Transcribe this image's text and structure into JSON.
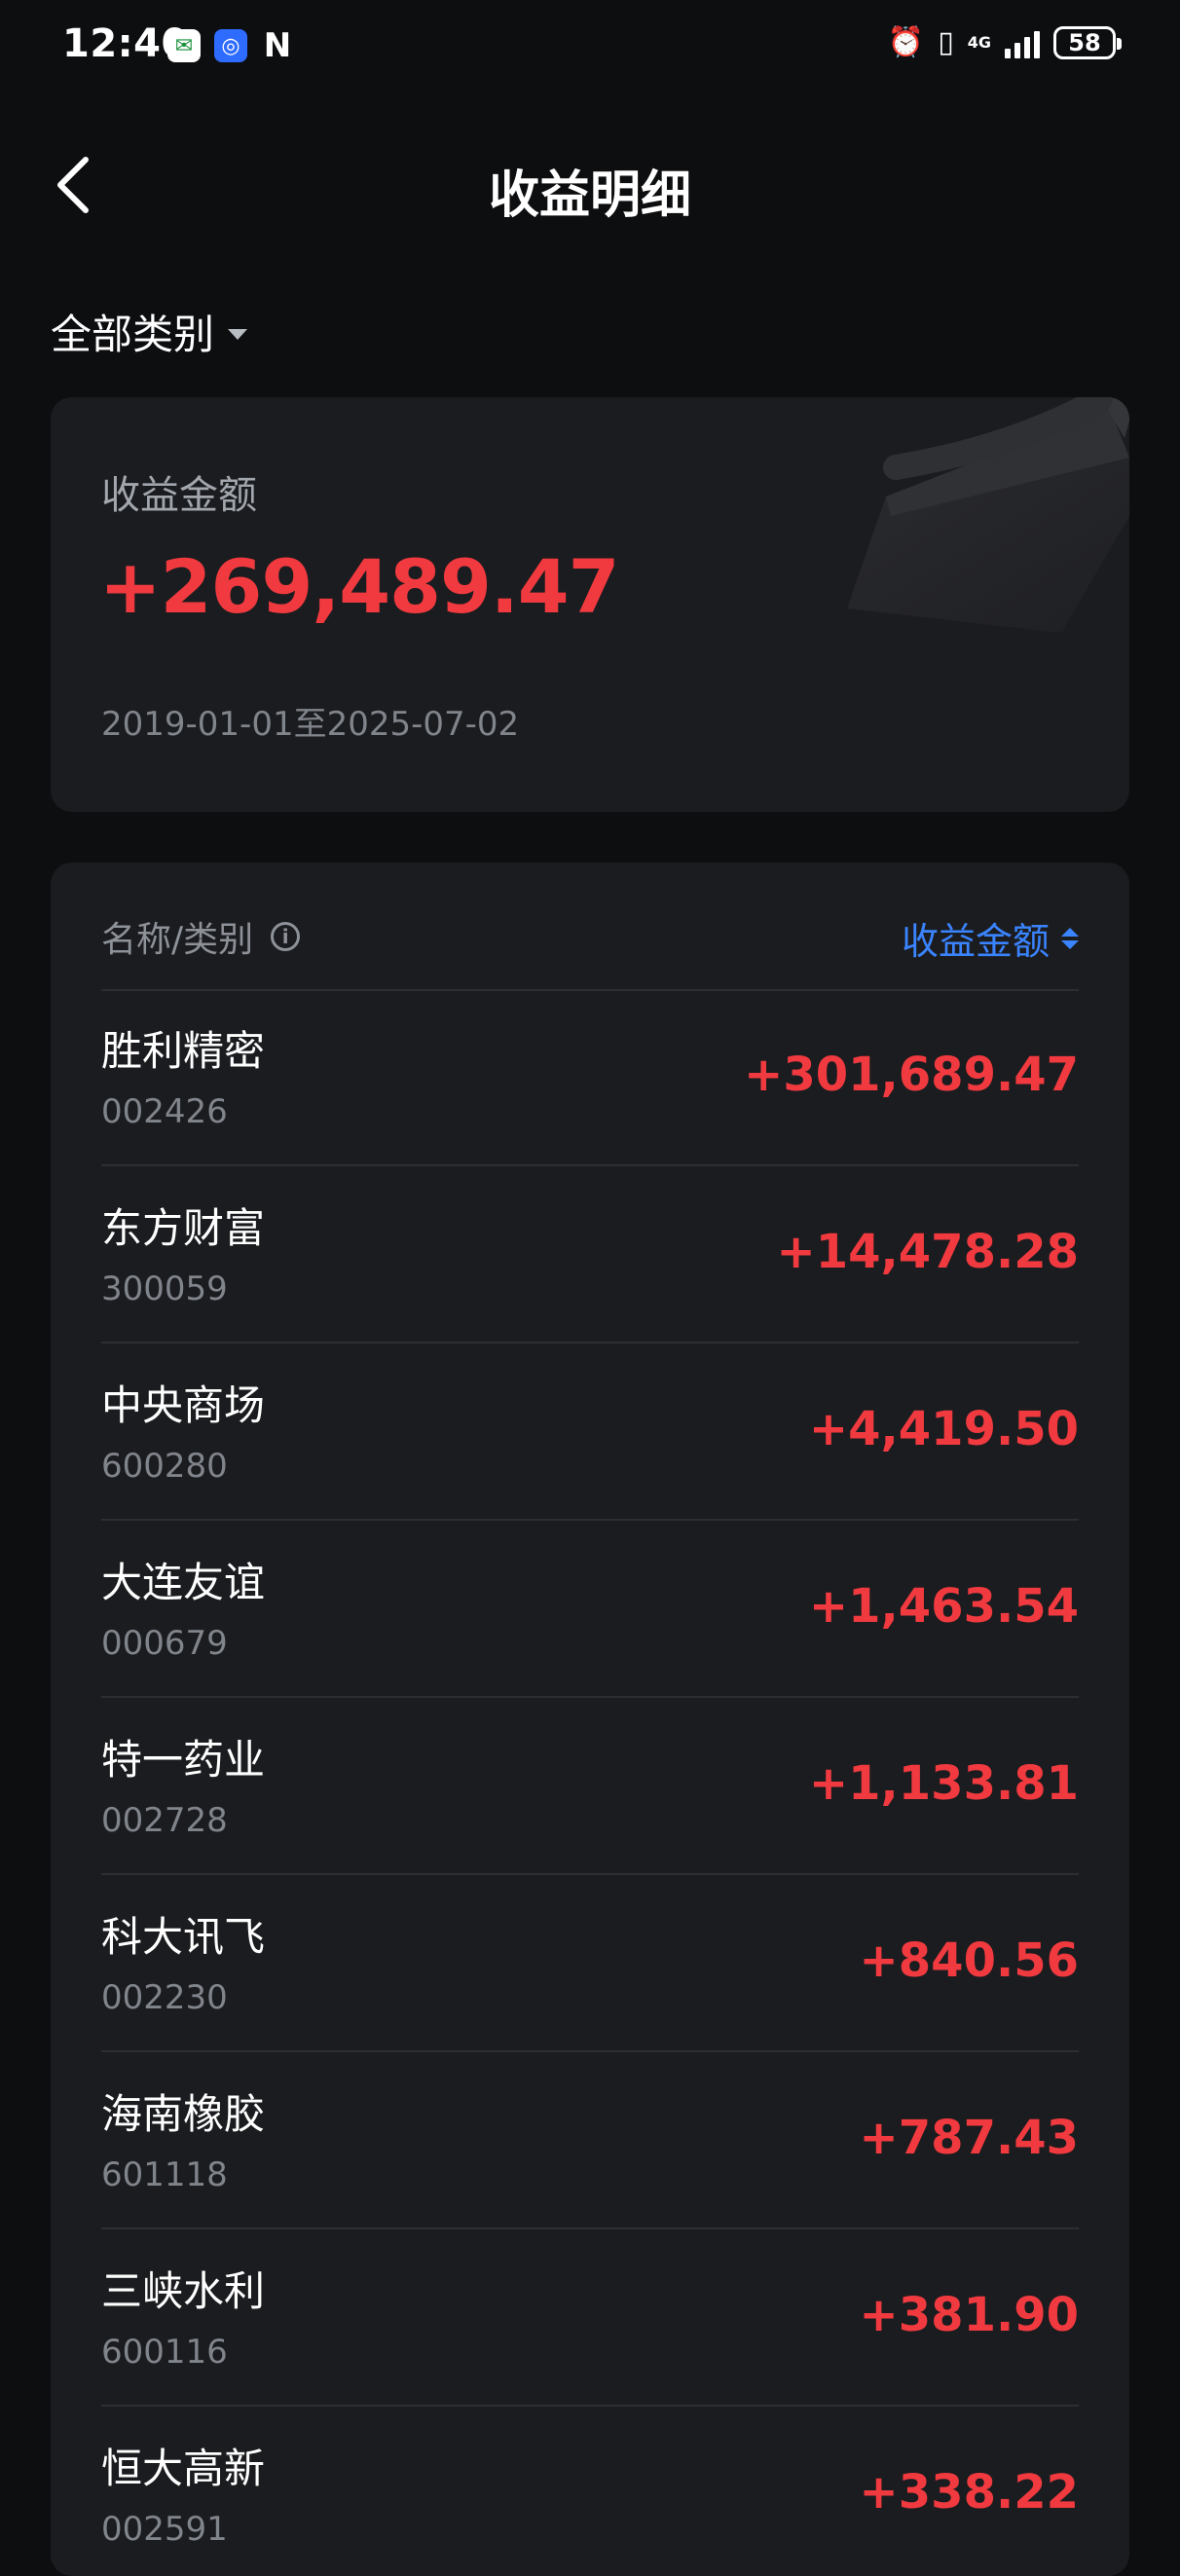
{
  "status_bar": {
    "time": "12:40",
    "network": "4G",
    "battery": "58",
    "icons": [
      "post-app-icon",
      "blue-app-icon",
      "nfc-icon",
      "alarm-icon",
      "vibrate-icon",
      "signal-icon",
      "battery-icon"
    ]
  },
  "header": {
    "title": "收益明细",
    "back_icon": "chevron-left-icon"
  },
  "filter": {
    "label": "全部类别"
  },
  "summary": {
    "label": "收益金额",
    "amount": "+269,489.47",
    "date_range": "2019-01-01至2025-07-02"
  },
  "list": {
    "column_name": "名称/类别",
    "column_amount": "收益金额",
    "rows": [
      {
        "name": "胜利精密",
        "code": "002426",
        "amount": "+301,689.47"
      },
      {
        "name": "东方财富",
        "code": "300059",
        "amount": "+14,478.28"
      },
      {
        "name": "中央商场",
        "code": "600280",
        "amount": "+4,419.50"
      },
      {
        "name": "大连友谊",
        "code": "000679",
        "amount": "+1,463.54"
      },
      {
        "name": "特一药业",
        "code": "002728",
        "amount": "+1,133.81"
      },
      {
        "name": "科大讯飞",
        "code": "002230",
        "amount": "+840.56"
      },
      {
        "name": "海南橡胶",
        "code": "601118",
        "amount": "+787.43"
      },
      {
        "name": "三峡水利",
        "code": "600116",
        "amount": "+381.90"
      },
      {
        "name": "恒大高新",
        "code": "002591",
        "amount": "+338.22"
      }
    ]
  },
  "colors": {
    "background": "#0d0e10",
    "card": "#1b1c1f",
    "gain_red": "#f03a3f",
    "accent_blue": "#3a84ff"
  }
}
